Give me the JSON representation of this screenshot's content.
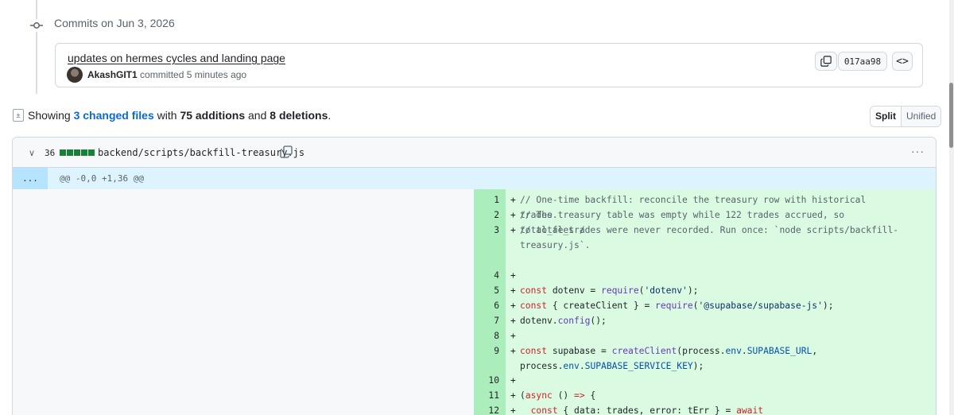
{
  "timeline": {
    "heading": "Commits on Jun 3, 2026"
  },
  "commit": {
    "title": "updates on hermes cycles and landing page",
    "author": "AkashGIT1",
    "meta": " committed 5 minutes ago",
    "sha": "017aa98",
    "browse_symbol": "<>"
  },
  "summary": {
    "prefix": "Showing ",
    "files_link": "3 changed files",
    "mid1": " with ",
    "additions": "75 additions",
    "mid2": " and ",
    "deletions": "8 deletions",
    "suffix": "."
  },
  "view_toggle": {
    "split": "Split",
    "unified": "Unified"
  },
  "file": {
    "chevron": "∨",
    "change_count": "36",
    "path": "backend/scripts/backfill-treasury.js",
    "kebab": "···",
    "hunk_expand": "...",
    "hunk_header": "@@ -0,0 +1,36 @@"
  },
  "lines": [
    {
      "n": "1",
      "t": "// One-time backfill: reconcile the treasury row with historical trades."
    },
    {
      "n": "2",
      "t": "// The treasury table was empty while 122 trades accrued, so total_fees /"
    },
    {
      "n": "3",
      "t": "// total_trades were never recorded. Run once: `node scripts/backfill-treasury.js`."
    },
    {
      "n": "4",
      "t": ""
    },
    {
      "n": "5",
      "t": "const dotenv = require('dotenv');"
    },
    {
      "n": "6",
      "t": "const { createClient } = require('@supabase/supabase-js');"
    },
    {
      "n": "7",
      "t": "dotenv.config();"
    },
    {
      "n": "8",
      "t": ""
    },
    {
      "n": "9",
      "t": "const supabase = createClient(process.env.SUPABASE_URL, process.env.SUPABASE_SERVICE_KEY);"
    },
    {
      "n": "10",
      "t": ""
    },
    {
      "n": "11",
      "t": "(async () => {"
    },
    {
      "n": "12",
      "t": "  const { data: trades, error: tErr } = await supabase.from('trades').select('fee');"
    }
  ],
  "colors": {
    "added_gutter": "#aceebb",
    "added_code": "#dafbe1",
    "hunk_bg": "#ddf4ff",
    "link": "#0969da",
    "diffstat_green": "#1a7f37"
  }
}
